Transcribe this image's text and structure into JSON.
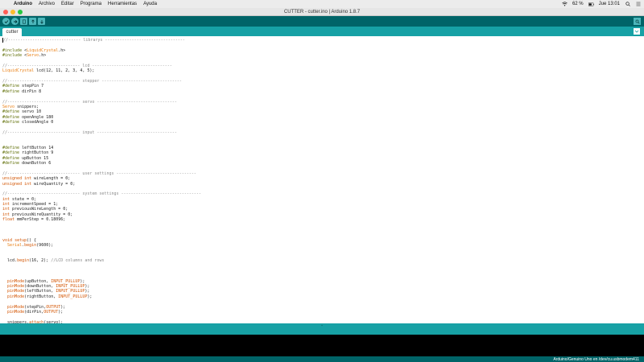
{
  "menubar": {
    "apple": "",
    "items": [
      "Arduino",
      "Archivo",
      "Editar",
      "Programa",
      "Herramientas",
      "Ayuda"
    ],
    "battery": "62 %",
    "clock": "Jue 13:01"
  },
  "window": {
    "title": "CUTTER - cutter.ino | Arduino 1.8.7"
  },
  "colors": {
    "toolbar": "#006468",
    "tabstrip": "#17a1a5",
    "console": "#000000"
  },
  "tabs": [
    {
      "label": "cutter"
    }
  ],
  "code": [
    "//------------------------------ librarys ---------------------------------",
    "",
    "#include <LiquidCrystal.h>",
    "#include <Servo.h>",
    "",
    "//------------------------------ lcd ---------------------------------",
    "LiquidCrystal lcd(12, 11, 2, 3, 4, 5);",
    "",
    "//------------------------------ stepper ---------------------------------",
    "#define stepPin 7",
    "#define dirPin 8",
    "",
    "//------------------------------ servo ---------------------------------",
    "Servo snippers;",
    "#define servo 10",
    "#define openAngle 180",
    "#define closedAngle 0",
    "",
    "//------------------------------ input ---------------------------------",
    "",
    "",
    "#define leftButton 14",
    "#define rightButton 9",
    "#define upButton 15",
    "#define downButton 6",
    "",
    "//------------------------------ user settings ---------------------------------",
    "unsigned int wireLength = 0;",
    "unsigned int wireQuantity = 0;",
    "",
    "//------------------------------ system settings ---------------------------------",
    "int state = 0;",
    "int incrementSpeed = 1;",
    "int previousWireLength = 0;",
    "int previousWireQuantity = 0;",
    "float mmPerStep = 0.18096;",
    "",
    "",
    "",
    "void setup() {",
    "  Serial.begin(9600);",
    "",
    "",
    "  lcd.begin(16, 2); //LCD columns and rows",
    "",
    "",
    "",
    "  pinMode(upButton, INPUT_PULLUP);",
    "  pinMode(downButton, INPUT_PULLUP);",
    "  pinMode(leftButton, INPUT_PULLUP);",
    "  pinMode(rightButton, INPUT_PULLUP);",
    "",
    "  pinMode(stepPin,OUTPUT);",
    "  pinMode(dirPin,OUTPUT);",
    "",
    "  snippers.attach(servo);"
  ],
  "status": {
    "board": "Arduino/Genuino Uno en /dev/cu.usbmodem411"
  }
}
